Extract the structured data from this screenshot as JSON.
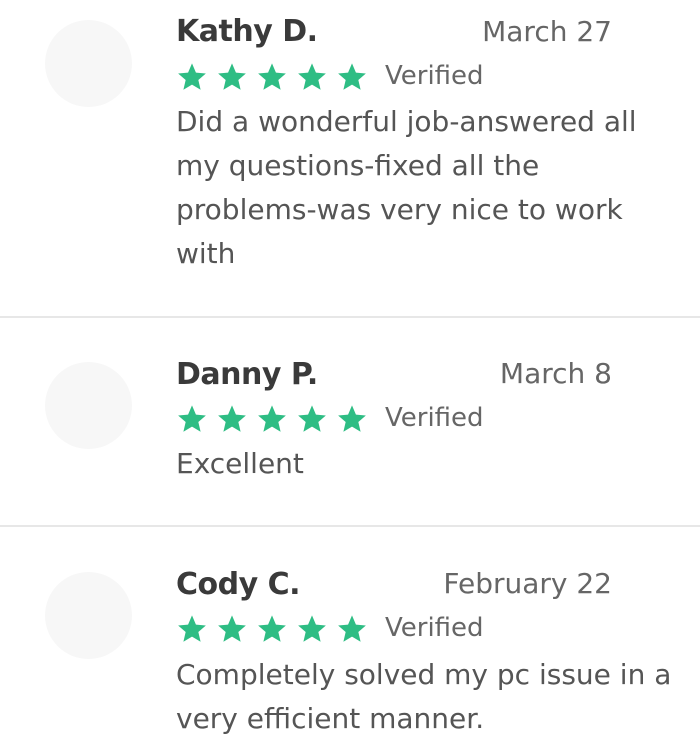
{
  "accent_color": "#2ebd84",
  "star_icon": "star-icon",
  "reviews": [
    {
      "name": "Kathy D.",
      "date": "March 27",
      "rating": 5,
      "verified_label": "Verified",
      "text": "Did a wonderful job-answered all my questions-fixed all the problems-was very nice to work with"
    },
    {
      "name": "Danny P.",
      "date": "March 8",
      "rating": 5,
      "verified_label": "Verified",
      "text": "Excellent"
    },
    {
      "name": "Cody C.",
      "date": "February 22",
      "rating": 5,
      "verified_label": "Verified",
      "text": "Completely solved my pc issue in a very efficient manner."
    }
  ]
}
